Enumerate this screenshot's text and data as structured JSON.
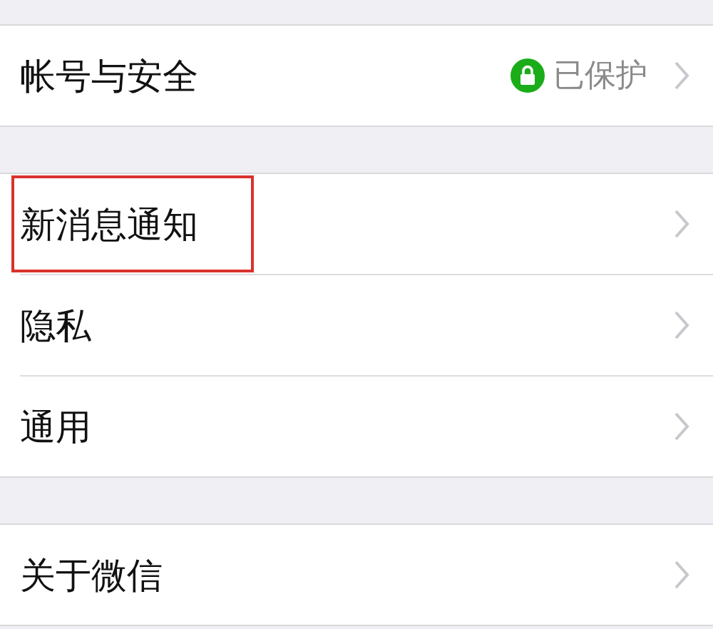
{
  "groups": [
    {
      "items": [
        {
          "label": "帐号与安全",
          "status": "已保护",
          "highlighted": false
        }
      ]
    },
    {
      "items": [
        {
          "label": "新消息通知",
          "highlighted": true
        },
        {
          "label": "隐私",
          "highlighted": false
        },
        {
          "label": "通用",
          "highlighted": false
        }
      ]
    },
    {
      "items": [
        {
          "label": "关于微信",
          "highlighted": false
        }
      ]
    }
  ]
}
